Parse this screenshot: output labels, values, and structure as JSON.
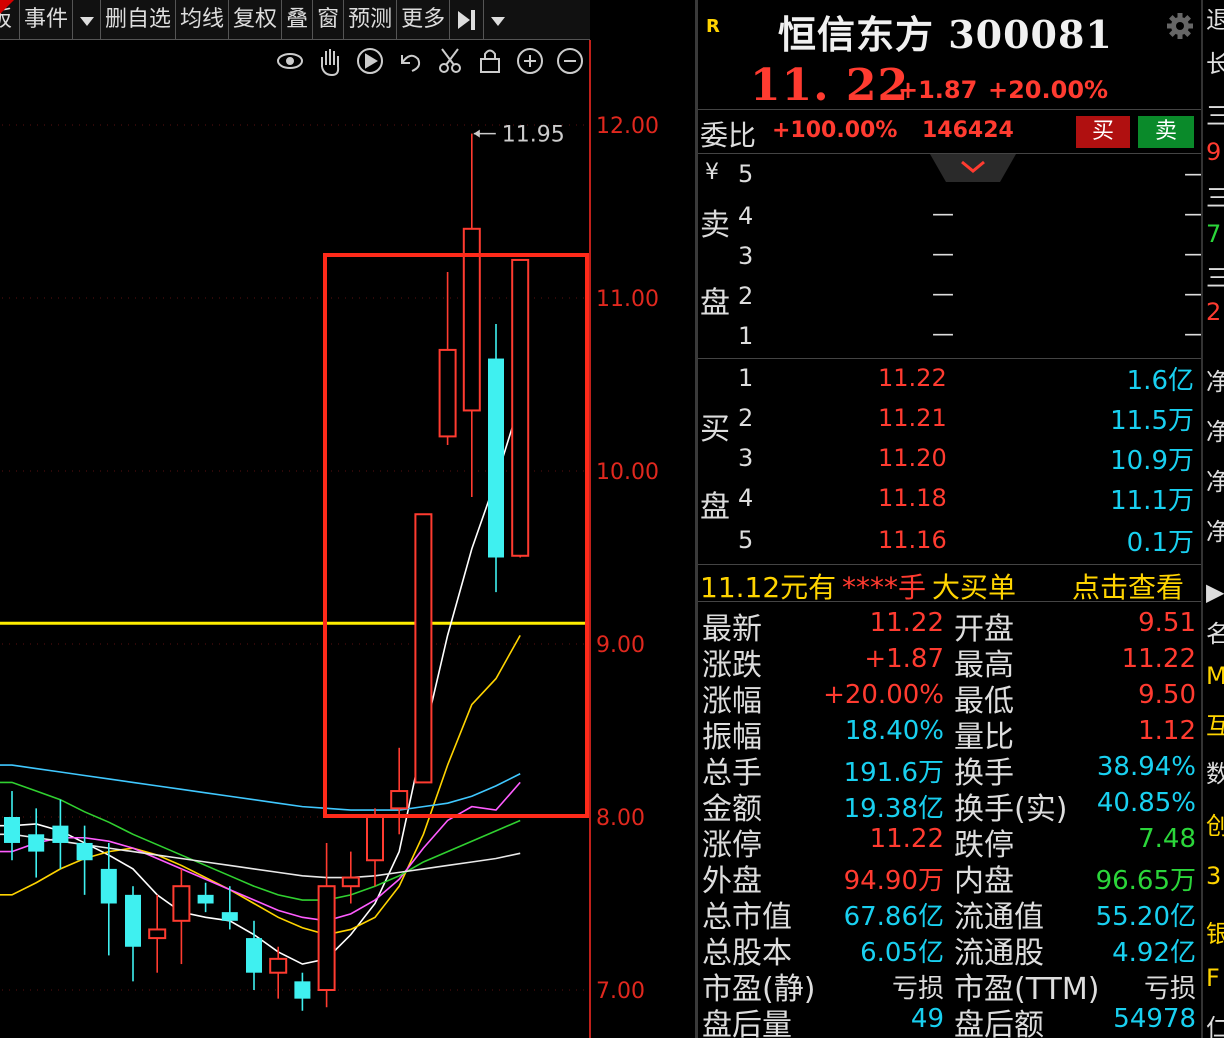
{
  "toolbar": {
    "items": [
      "板",
      "事件",
      "删自选",
      "均线",
      "复权",
      "叠",
      "窗",
      "预测",
      "更多"
    ],
    "next_icon": "skip-forward-icon"
  },
  "chart_tools": [
    "eye-icon",
    "hand-icon",
    "play-icon",
    "undo-icon",
    "scissors-icon",
    "lock-icon",
    "zoom-in-icon",
    "zoom-out-icon"
  ],
  "chart_data": {
    "type": "candlestick",
    "y_ticks": [
      "12.00",
      "11.00",
      "10.00",
      "9.00",
      "8.00",
      "7.00"
    ],
    "ylim": [
      6.9,
      12.4
    ],
    "high_annotation": "11.95",
    "reference_line": 9.12,
    "colors": {
      "up": "#ff3b30",
      "down": "#3ff0f0",
      "ref": "#ffee00",
      "box": "#ff2a1a"
    },
    "candles": [
      {
        "o": 8.0,
        "h": 8.15,
        "l": 7.75,
        "c": 7.85
      },
      {
        "o": 7.9,
        "h": 8.05,
        "l": 7.65,
        "c": 7.8
      },
      {
        "o": 7.95,
        "h": 8.1,
        "l": 7.7,
        "c": 7.85
      },
      {
        "o": 7.85,
        "h": 7.95,
        "l": 7.55,
        "c": 7.75
      },
      {
        "o": 7.7,
        "h": 7.85,
        "l": 7.2,
        "c": 7.5
      },
      {
        "o": 7.55,
        "h": 7.6,
        "l": 7.05,
        "c": 7.25
      },
      {
        "o": 7.3,
        "h": 7.55,
        "l": 7.1,
        "c": 7.35
      },
      {
        "o": 7.4,
        "h": 7.7,
        "l": 7.15,
        "c": 7.6
      },
      {
        "o": 7.55,
        "h": 7.62,
        "l": 7.45,
        "c": 7.5
      },
      {
        "o": 7.45,
        "h": 7.6,
        "l": 7.35,
        "c": 7.4
      },
      {
        "o": 7.3,
        "h": 7.4,
        "l": 7.0,
        "c": 7.1
      },
      {
        "o": 7.1,
        "h": 7.25,
        "l": 6.95,
        "c": 7.18
      },
      {
        "o": 7.05,
        "h": 7.1,
        "l": 6.88,
        "c": 6.95
      },
      {
        "o": 7.0,
        "h": 7.85,
        "l": 6.9,
        "c": 7.6
      },
      {
        "o": 7.6,
        "h": 7.8,
        "l": 7.5,
        "c": 7.65
      },
      {
        "o": 7.75,
        "h": 8.05,
        "l": 7.6,
        "c": 8.0
      },
      {
        "o": 8.05,
        "h": 8.4,
        "l": 7.9,
        "c": 8.15
      },
      {
        "o": 8.2,
        "h": 9.75,
        "l": 8.2,
        "c": 9.75
      },
      {
        "o": 10.2,
        "h": 11.15,
        "l": 10.15,
        "c": 10.7
      },
      {
        "o": 10.35,
        "h": 11.95,
        "l": 9.85,
        "c": 11.4
      },
      {
        "o": 10.65,
        "h": 10.85,
        "l": 9.3,
        "c": 9.5
      },
      {
        "o": 9.51,
        "h": 11.22,
        "l": 9.5,
        "c": 11.22
      }
    ],
    "ma": [
      {
        "color": "#ffffff",
        "values": [
          7.95,
          7.96,
          7.92,
          7.85,
          7.78,
          7.7,
          7.55,
          7.45,
          7.42,
          7.4,
          7.32,
          7.22,
          7.15,
          7.18,
          7.32,
          7.5,
          7.8,
          8.45,
          9.05,
          9.55,
          9.95,
          10.4
        ]
      },
      {
        "color": "#ffd400",
        "values": [
          7.55,
          7.62,
          7.7,
          7.76,
          7.8,
          7.82,
          7.78,
          7.72,
          7.65,
          7.58,
          7.5,
          7.42,
          7.36,
          7.32,
          7.35,
          7.42,
          7.6,
          7.9,
          8.3,
          8.65,
          8.8,
          9.05
        ]
      },
      {
        "color": "#ff5cff",
        "values": [
          7.8,
          7.85,
          7.88,
          7.88,
          7.86,
          7.82,
          7.76,
          7.7,
          7.64,
          7.58,
          7.52,
          7.46,
          7.42,
          7.4,
          7.44,
          7.52,
          7.64,
          7.82,
          7.98,
          8.06,
          8.04,
          8.2
        ]
      },
      {
        "color": "#30d030",
        "values": [
          8.2,
          8.15,
          8.1,
          8.03,
          7.97,
          7.9,
          7.84,
          7.78,
          7.72,
          7.66,
          7.6,
          7.55,
          7.52,
          7.52,
          7.55,
          7.6,
          7.66,
          7.74,
          7.8,
          7.86,
          7.92,
          7.98
        ]
      },
      {
        "color": "#40c8ff",
        "values": [
          8.3,
          8.28,
          8.26,
          8.24,
          8.22,
          8.2,
          8.18,
          8.16,
          8.14,
          8.12,
          8.1,
          8.08,
          8.06,
          8.05,
          8.04,
          8.04,
          8.04,
          8.06,
          8.08,
          8.12,
          8.18,
          8.25
        ]
      },
      {
        "color": "#e8e8e8",
        "values": [
          7.9,
          7.88,
          7.86,
          7.84,
          7.82,
          7.8,
          7.78,
          7.76,
          7.74,
          7.72,
          7.7,
          7.68,
          7.66,
          7.65,
          7.65,
          7.66,
          7.68,
          7.7,
          7.72,
          7.74,
          7.76,
          7.79
        ]
      }
    ]
  },
  "header": {
    "badge": "R",
    "name": "恒信东方 300081",
    "price": "11. 22",
    "change": "+1.87",
    "change_pct": "+20.00%",
    "weibi_label": "委比",
    "weibi_pct": "+100.00%",
    "weibi_num": "146424",
    "buy_button": "买",
    "sell_button": "卖"
  },
  "book": {
    "sell_label_chars": [
      "卖",
      "盘"
    ],
    "sell_levels": [
      "5",
      "4",
      "3",
      "2",
      "1"
    ],
    "buy_label_chars": [
      "买",
      "盘"
    ],
    "currency": "¥",
    "buy": [
      {
        "lvl": "1",
        "price": "11.22",
        "vol": "1.6亿"
      },
      {
        "lvl": "2",
        "price": "11.21",
        "vol": "11.5万"
      },
      {
        "lvl": "3",
        "price": "11.20",
        "vol": "10.9万"
      },
      {
        "lvl": "4",
        "price": "11.18",
        "vol": "11.1万"
      },
      {
        "lvl": "5",
        "price": "11.16",
        "vol": "0.1万"
      }
    ]
  },
  "big_order": {
    "price": "11.12元有",
    "stars": "****手",
    "text": "大买单",
    "link": "点击查看"
  },
  "quote": {
    "left": [
      {
        "label": "最新",
        "value": "11.22",
        "color": "red"
      },
      {
        "label": "涨跌",
        "value": "+1.87",
        "color": "red"
      },
      {
        "label": "涨幅",
        "value": "+20.00%",
        "color": "red"
      },
      {
        "label": "振幅",
        "value": "18.40%",
        "color": "cyan"
      },
      {
        "label": "总手",
        "value": "191.6万",
        "color": "cyan"
      },
      {
        "label": "金额",
        "value": "19.38亿",
        "color": "cyan"
      },
      {
        "label": "涨停",
        "value": "11.22",
        "color": "red"
      },
      {
        "label": "外盘",
        "value": "94.90万",
        "color": "red"
      },
      {
        "label": "总市值",
        "value": "67.86亿",
        "color": "cyan"
      },
      {
        "label": "总股本",
        "value": "6.05亿",
        "color": "cyan"
      },
      {
        "label": "市盈(静)",
        "value": "亏损",
        "color": "white"
      },
      {
        "label": "盘后量",
        "value": "49",
        "color": "cyan"
      }
    ],
    "right": [
      {
        "label": "开盘",
        "value": "9.51",
        "color": "red"
      },
      {
        "label": "最高",
        "value": "11.22",
        "color": "red"
      },
      {
        "label": "最低",
        "value": "9.50",
        "color": "red"
      },
      {
        "label": "量比",
        "value": "1.12",
        "color": "red"
      },
      {
        "label": "换手",
        "value": "38.94%",
        "color": "cyan"
      },
      {
        "label": "换手(实)",
        "value": "40.85%",
        "color": "cyan"
      },
      {
        "label": "跌停",
        "value": "7.48",
        "color": "green"
      },
      {
        "label": "内盘",
        "value": "96.65万",
        "color": "green"
      },
      {
        "label": "流通值",
        "value": "55.20亿",
        "color": "cyan"
      },
      {
        "label": "流通股",
        "value": "4.92亿",
        "color": "cyan"
      },
      {
        "label": "市盈(TTM)",
        "value": "亏损",
        "color": "white"
      },
      {
        "label": "盘后额",
        "value": "54978",
        "color": "cyan"
      }
    ]
  },
  "right_edge": [
    "退",
    "长",
    "三",
    "9",
    "三",
    "7",
    "三",
    "2",
    "净",
    "净",
    "净",
    "净",
    "▶",
    "名",
    "M",
    "互",
    "数",
    "创",
    "3",
    "银",
    "F",
    "仁"
  ]
}
